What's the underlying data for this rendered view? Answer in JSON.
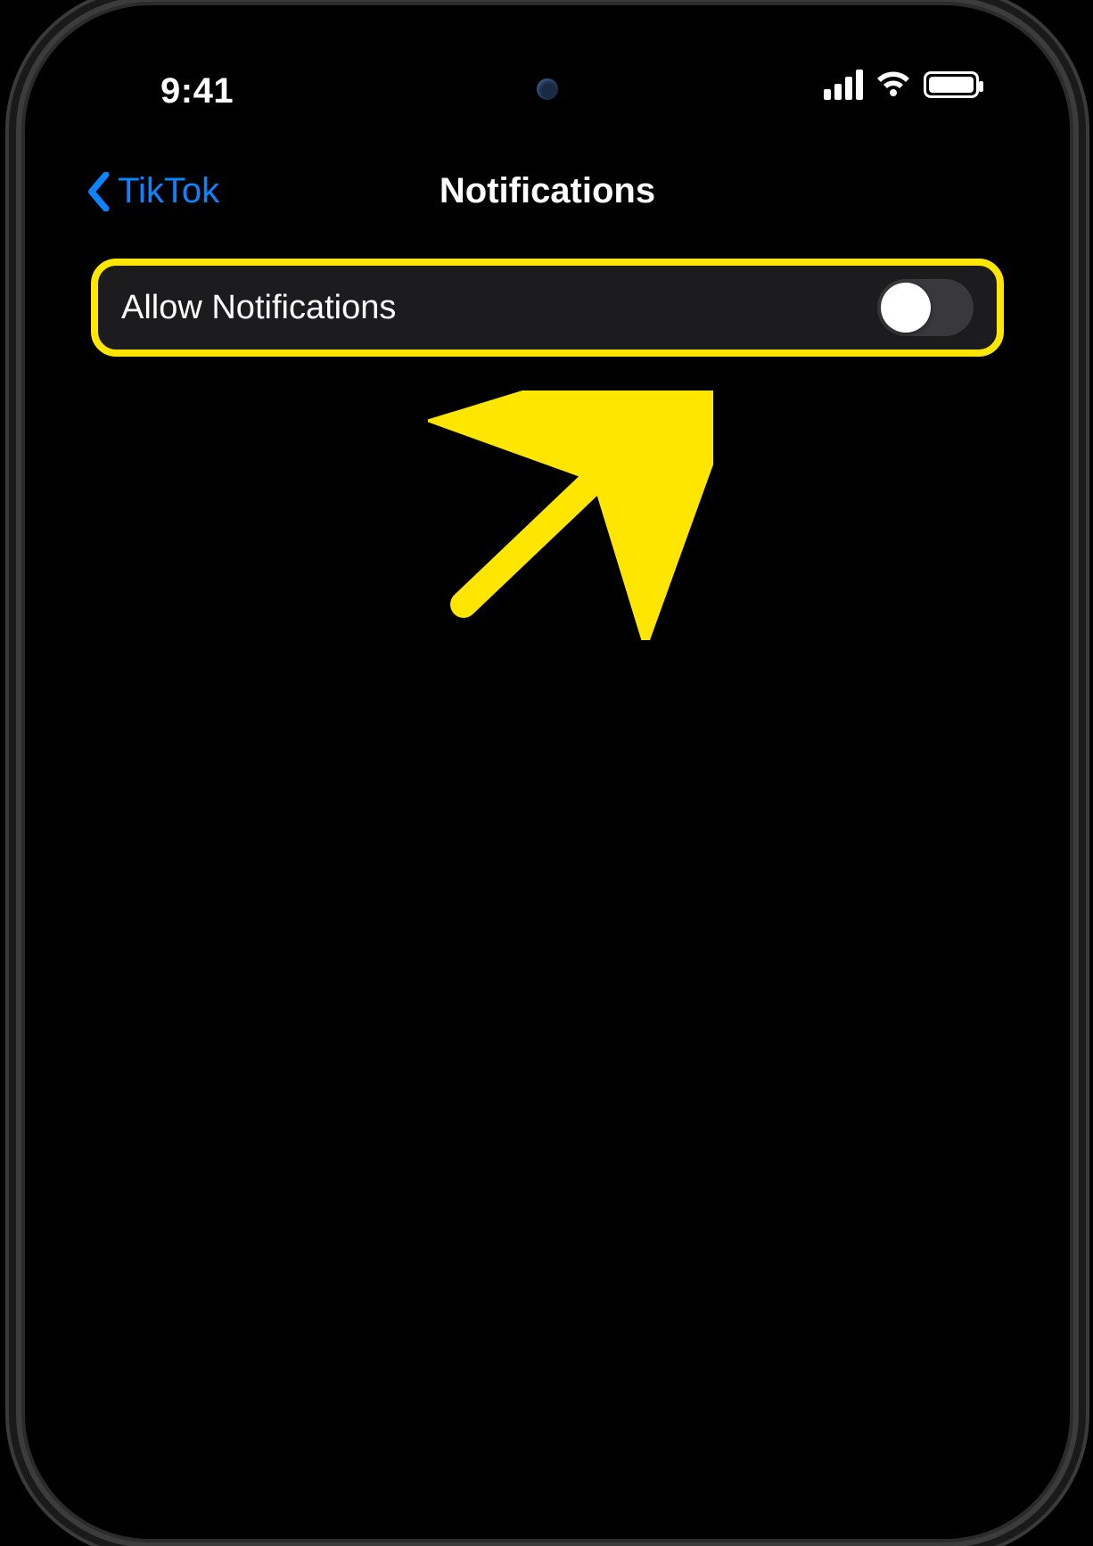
{
  "status": {
    "time": "9:41"
  },
  "nav": {
    "back_label": "TikTok",
    "title": "Notifications"
  },
  "settings": {
    "allow_notifications": {
      "label": "Allow Notifications",
      "state": "off"
    }
  },
  "annotation": {
    "highlight_color": "#ffe600",
    "arrow_color": "#ffe600"
  }
}
